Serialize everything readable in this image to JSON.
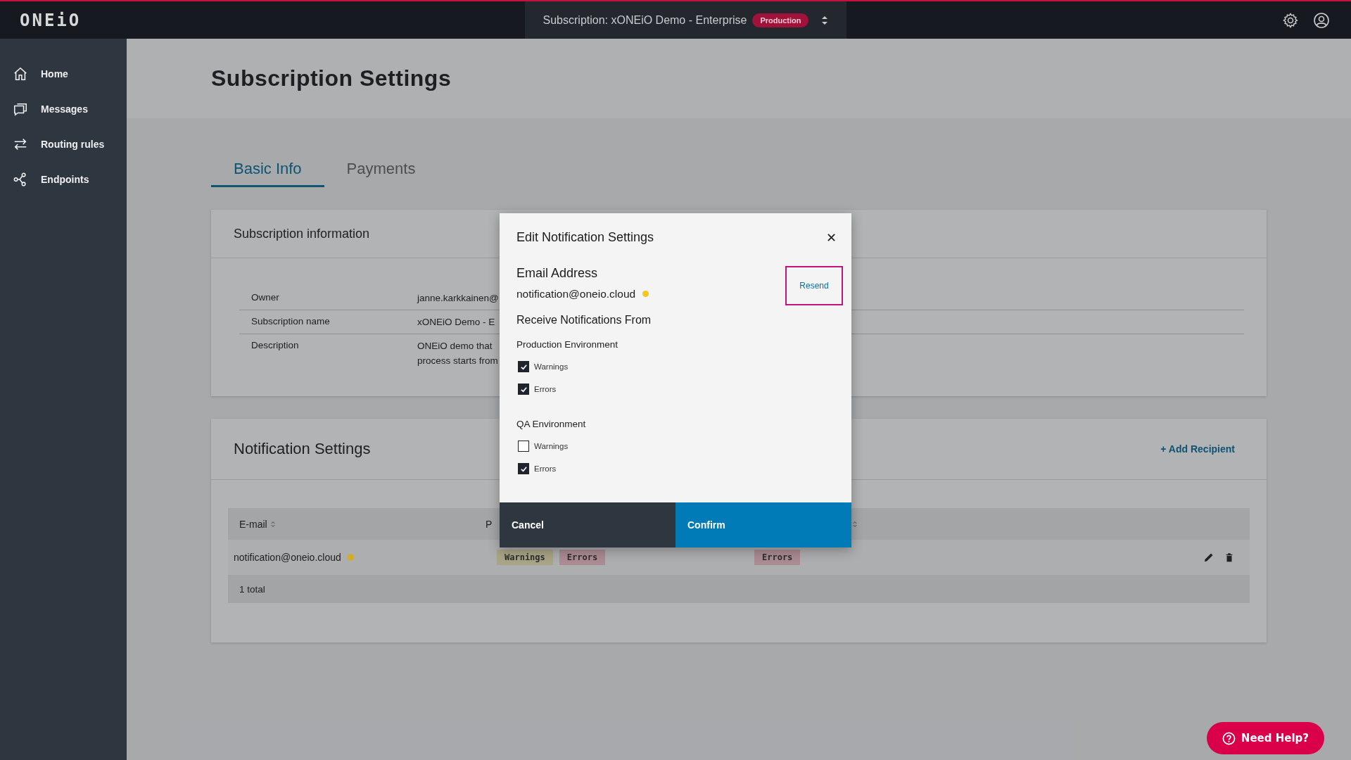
{
  "topbar": {
    "logo": "ONEiO",
    "subscription": "Subscription: xONEiO Demo - Enterprise",
    "environment_badge": "Production"
  },
  "sidebar": {
    "items": [
      {
        "label": "Home"
      },
      {
        "label": "Messages"
      },
      {
        "label": "Routing rules"
      },
      {
        "label": "Endpoints"
      }
    ]
  },
  "page": {
    "title": "Subscription Settings"
  },
  "tabs": [
    {
      "label": "Basic Info",
      "selected": true
    },
    {
      "label": "Payments",
      "selected": false
    }
  ],
  "subscription_info": {
    "title": "Subscription information",
    "rows": [
      {
        "label": "Owner",
        "value": [
          "janne.karkkainen@"
        ]
      },
      {
        "label": "Subscription name",
        "value": [
          "xONEiO Demo - E"
        ]
      },
      {
        "label": "Description",
        "value": [
          "ONEiO demo that",
          "process starts from"
        ]
      }
    ]
  },
  "notification_settings": {
    "title": "Notification Settings",
    "add_link": "+ Add Recipient",
    "table": {
      "columns": [
        "E-mail",
        "P"
      ],
      "rows": [
        {
          "email": "notification@oneio.cloud",
          "color": "#d1ad2e",
          "production": [
            {
              "label": "Warnings",
              "kind": "warning"
            },
            {
              "label": "Errors",
              "kind": "error"
            }
          ],
          "qa": [
            {
              "label": "Errors",
              "kind": "error"
            }
          ]
        }
      ],
      "total": "1 total"
    }
  },
  "modal": {
    "title": "Edit Notification Settings",
    "email_heading": "Email Address",
    "email": {
      "address": "notification@oneio.cloud",
      "color": "#f2c81c"
    },
    "resend": "Resend",
    "receive_heading": "Receive Notifications From",
    "groups": [
      {
        "title": "Production Environment",
        "options": [
          {
            "label": "Warnings",
            "checked": true
          },
          {
            "label": "Errors",
            "checked": true
          }
        ]
      },
      {
        "title": "QA Environment",
        "options": [
          {
            "label": "Warnings",
            "checked": false
          },
          {
            "label": "Errors",
            "checked": true
          }
        ]
      }
    ],
    "cancel": "Cancel",
    "confirm": "Confirm"
  },
  "help_button": "Need Help?"
}
